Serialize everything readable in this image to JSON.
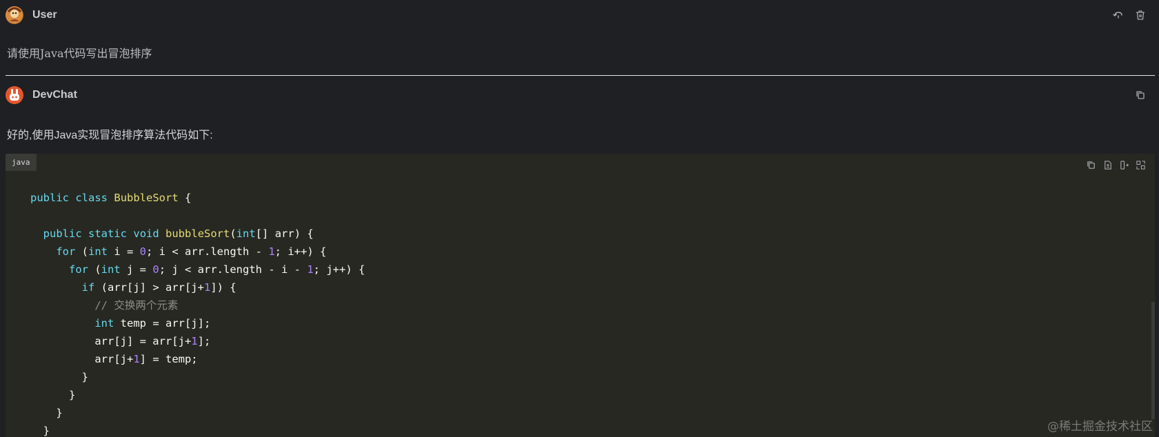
{
  "user_message": {
    "author": "User",
    "text": "请使用Java代码写出冒泡排序",
    "actions": [
      {
        "name": "reply-icon"
      },
      {
        "name": "trash-icon"
      }
    ]
  },
  "bot_message": {
    "author": "DevChat",
    "intro": "好的,使用Java实现冒泡排序算法代码如下:",
    "actions": [
      {
        "name": "copy-icon"
      }
    ]
  },
  "code_block": {
    "language": "java",
    "toolbar": [
      {
        "name": "copy-code-icon"
      },
      {
        "name": "diff-file-icon"
      },
      {
        "name": "insert-code-icon"
      },
      {
        "name": "replace-code-icon"
      }
    ],
    "lines": [
      [
        [
          "kw",
          "public"
        ],
        [
          "p",
          " "
        ],
        [
          "kw",
          "class"
        ],
        [
          "p",
          " "
        ],
        [
          "fn",
          "BubbleSort"
        ],
        [
          "p",
          " {"
        ]
      ],
      [],
      [
        [
          "p",
          "  "
        ],
        [
          "kw",
          "public"
        ],
        [
          "p",
          " "
        ],
        [
          "kw",
          "static"
        ],
        [
          "p",
          " "
        ],
        [
          "kw",
          "void"
        ],
        [
          "p",
          " "
        ],
        [
          "fn",
          "bubbleSort"
        ],
        [
          "p",
          "("
        ],
        [
          "kw",
          "int"
        ],
        [
          "p",
          "[] arr) {"
        ]
      ],
      [
        [
          "p",
          "    "
        ],
        [
          "kw",
          "for"
        ],
        [
          "p",
          " ("
        ],
        [
          "kw",
          "int"
        ],
        [
          "p",
          " i = "
        ],
        [
          "num",
          "0"
        ],
        [
          "p",
          "; i < arr.length - "
        ],
        [
          "num",
          "1"
        ],
        [
          "p",
          "; i++) {"
        ]
      ],
      [
        [
          "p",
          "      "
        ],
        [
          "kw",
          "for"
        ],
        [
          "p",
          " ("
        ],
        [
          "kw",
          "int"
        ],
        [
          "p",
          " j = "
        ],
        [
          "num",
          "0"
        ],
        [
          "p",
          "; j < arr.length - i - "
        ],
        [
          "num",
          "1"
        ],
        [
          "p",
          "; j++) {"
        ]
      ],
      [
        [
          "p",
          "        "
        ],
        [
          "kw",
          "if"
        ],
        [
          "p",
          " (arr[j] > arr[j+"
        ],
        [
          "num",
          "1"
        ],
        [
          "p",
          "]) {"
        ]
      ],
      [
        [
          "p",
          "          "
        ],
        [
          "cmt",
          "// 交换两个元素"
        ]
      ],
      [
        [
          "p",
          "          "
        ],
        [
          "kw",
          "int"
        ],
        [
          "p",
          " temp = arr[j];"
        ]
      ],
      [
        [
          "p",
          "          arr[j] = arr[j+"
        ],
        [
          "num",
          "1"
        ],
        [
          "p",
          "];"
        ]
      ],
      [
        [
          "p",
          "          arr[j+"
        ],
        [
          "num",
          "1"
        ],
        [
          "p",
          "] = temp;"
        ]
      ],
      [
        [
          "p",
          "        }"
        ]
      ],
      [
        [
          "p",
          "      }"
        ]
      ],
      [
        [
          "p",
          "    }"
        ]
      ],
      [
        [
          "p",
          "  }"
        ]
      ]
    ]
  },
  "watermark": "@稀土掘金技术社区",
  "colors": {
    "background": "#1f2023",
    "code_background": "#272822",
    "keyword": "#66d9ef",
    "function": "#e6db74",
    "number": "#ae81ff",
    "comment": "#8b8d86"
  }
}
